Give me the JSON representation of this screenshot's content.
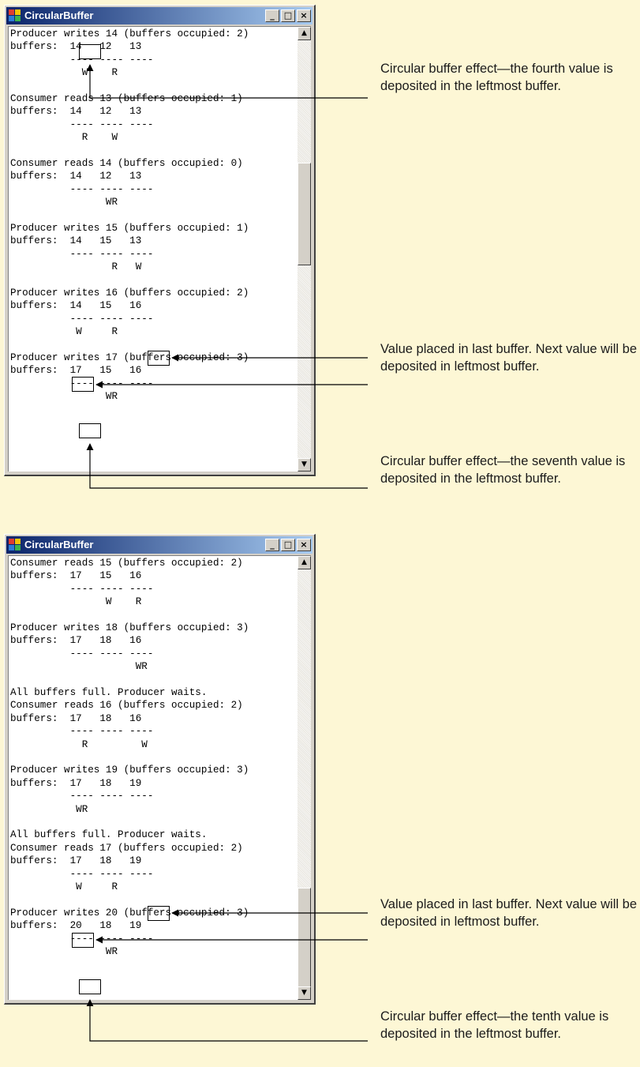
{
  "windows": [
    {
      "title": "CircularBuffer",
      "controls": {
        "minimize": "_",
        "maximize": "□",
        "close": "×"
      },
      "lines": [
        "Producer writes 14 (buffers occupied: 2)",
        "buffers:  14   12   13",
        "          ---- ---- ----",
        "            W    R",
        "",
        "Consumer reads 13 (buffers occupied: 1)",
        "buffers:  14   12   13",
        "          ---- ---- ----",
        "            R    W",
        "",
        "Consumer reads 14 (buffers occupied: 0)",
        "buffers:  14   12   13",
        "          ---- ---- ----",
        "                WR",
        "",
        "Producer writes 15 (buffers occupied: 1)",
        "buffers:  14   15   13",
        "          ---- ---- ----",
        "                 R   W",
        "",
        "Producer writes 16 (buffers occupied: 2)",
        "buffers:  14   15   16",
        "          ---- ---- ----",
        "           W     R",
        "",
        "Producer writes 17 (buffers occupied: 3)",
        "buffers:  17   15   16",
        "          ---- ---- ----",
        "                WR"
      ]
    },
    {
      "title": "CircularBuffer",
      "controls": {
        "minimize": "_",
        "maximize": "□",
        "close": "×"
      },
      "lines": [
        "Consumer reads 15 (buffers occupied: 2)",
        "buffers:  17   15   16",
        "          ---- ---- ----",
        "                W    R",
        "",
        "Producer writes 18 (buffers occupied: 3)",
        "buffers:  17   18   16",
        "          ---- ---- ----",
        "                     WR",
        "",
        "All buffers full. Producer waits.",
        "Consumer reads 16 (buffers occupied: 2)",
        "buffers:  17   18   16",
        "          ---- ---- ----",
        "            R         W",
        "",
        "Producer writes 19 (buffers occupied: 3)",
        "buffers:  17   18   19",
        "          ---- ---- ----",
        "           WR",
        "",
        "All buffers full. Producer waits.",
        "Consumer reads 17 (buffers occupied: 2)",
        "buffers:  17   18   19",
        "          ---- ---- ----",
        "           W     R",
        "",
        "Producer writes 20 (buffers occupied: 3)",
        "buffers:  20   18   19",
        "          ---- ---- ----",
        "                WR"
      ]
    }
  ],
  "annotations": [
    "Circular buffer effect—the fourth value is deposited in the leftmost buffer.",
    "Value placed in last buffer. Next value will be deposited in leftmost buffer.",
    "Circular buffer effect—the seventh value is deposited in the leftmost buffer.",
    "Value placed in last buffer. Next value will be deposited in leftmost buffer.",
    "Circular buffer effect—the tenth value is deposited in the leftmost buffer."
  ],
  "colors": {
    "page_background": "#fdf7d5",
    "title_gradient_start": "#0a246a",
    "title_gradient_end": "#a6caf0"
  }
}
